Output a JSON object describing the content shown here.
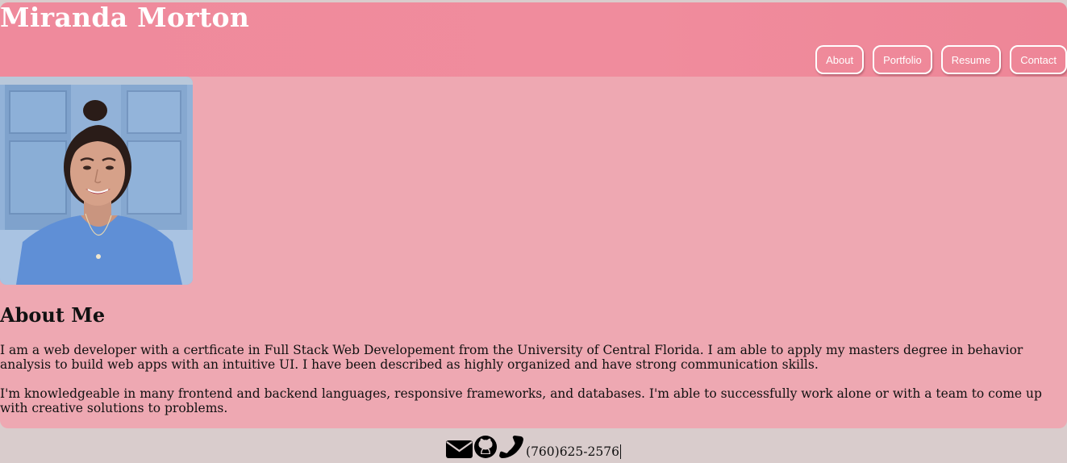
{
  "header": {
    "title": "Miranda Morton",
    "nav": [
      "About",
      "Portfolio",
      "Resume",
      "Contact"
    ]
  },
  "about": {
    "heading": "About Me",
    "paragraphs": [
      "I am a web developer with a certficate in Full Stack Web Developement from the University of Central Florida. I am able to apply my masters degree in behavior analysis to build web apps with an intuitive UI. I have been described as highly organized and have strong communication skills.",
      "I'm knowledgeable in many frontend and backend languages, responsive frameworks, and databases. I'm able to successfully work alone or with a team to come up with creative solutions to problems."
    ]
  },
  "footer": {
    "icons": [
      "envelope-icon",
      "github-icon",
      "phone-icon"
    ],
    "phone": "(760)625-2576"
  },
  "colors": {
    "header": "#f08c9d",
    "card": "#eea8b2",
    "page": "#d9cccc"
  }
}
